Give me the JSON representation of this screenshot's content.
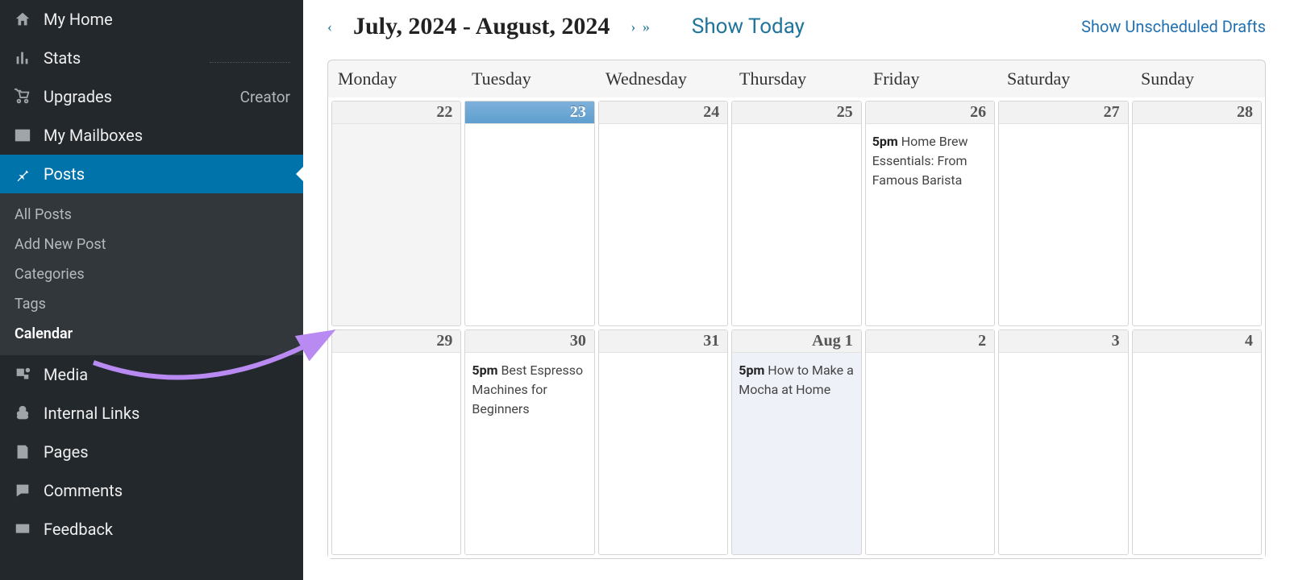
{
  "sidebar": {
    "items": [
      {
        "icon": "home",
        "label": "My Home"
      },
      {
        "icon": "stats",
        "label": "Stats",
        "dotted": true
      },
      {
        "icon": "cart",
        "label": "Upgrades",
        "badge": "Creator"
      },
      {
        "icon": "mail",
        "label": "My Mailboxes"
      },
      {
        "icon": "pin",
        "label": "Posts",
        "active": true
      }
    ],
    "sub": [
      {
        "label": "All Posts"
      },
      {
        "label": "Add New Post"
      },
      {
        "label": "Categories"
      },
      {
        "label": "Tags"
      },
      {
        "label": "Calendar",
        "current": true
      }
    ],
    "items2": [
      {
        "icon": "media",
        "label": "Media"
      },
      {
        "icon": "links",
        "label": "Internal Links"
      },
      {
        "icon": "pages",
        "label": "Pages"
      },
      {
        "icon": "comment",
        "label": "Comments"
      },
      {
        "icon": "feedback",
        "label": "Feedback"
      }
    ]
  },
  "calendar": {
    "nav_prev": "‹",
    "title": "July, 2024 - August, 2024",
    "nav_fwd_single": "›",
    "nav_fwd_double": "»",
    "show_today": "Show Today",
    "show_drafts": "Show Unscheduled Drafts",
    "weekdays": [
      "Monday",
      "Tuesday",
      "Wednesday",
      "Thursday",
      "Friday",
      "Saturday",
      "Sunday"
    ],
    "rows": [
      [
        {
          "date": "22",
          "past": true
        },
        {
          "date": "23",
          "today": true
        },
        {
          "date": "24"
        },
        {
          "date": "25"
        },
        {
          "date": "26",
          "event_time": "5pm",
          "event_text": "Home Brew Essentials: From Famous Barista"
        },
        {
          "date": "27"
        },
        {
          "date": "28"
        }
      ],
      [
        {
          "date": "29"
        },
        {
          "date": "30",
          "event_time": "5pm",
          "event_text": "Best Espresso Machines for Beginners"
        },
        {
          "date": "31"
        },
        {
          "date": "Aug 1",
          "highlight": true,
          "event_time": "5pm",
          "event_text": "How to Make a Mocha at Home"
        },
        {
          "date": "2"
        },
        {
          "date": "3"
        },
        {
          "date": "4"
        }
      ]
    ]
  }
}
